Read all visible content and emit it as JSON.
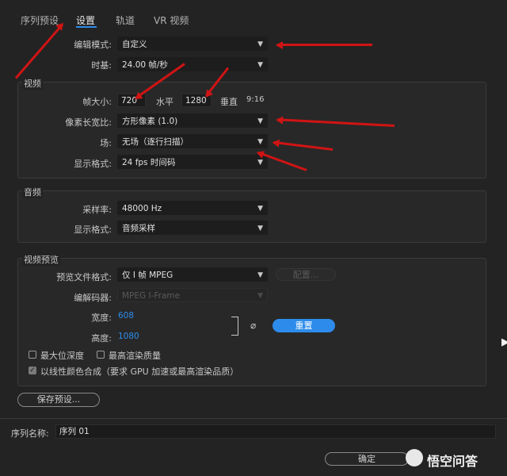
{
  "tabs": [
    {
      "label": "序列预设"
    },
    {
      "label": "设置"
    },
    {
      "label": "轨道"
    },
    {
      "label": "VR 视频"
    }
  ],
  "general": {
    "edit_mode_label": "编辑模式:",
    "edit_mode_value": "自定义",
    "timebase_label": "时基:",
    "timebase_value": "24.00 帧/秒"
  },
  "video": {
    "title": "视频",
    "frame_size_label": "帧大小:",
    "frame_width": "720",
    "horizontal_label": "水平",
    "frame_height": "1280",
    "vertical_label": "垂直",
    "aspect": "9:16",
    "pixel_aspect_label": "像素长宽比:",
    "pixel_aspect_value": "方形像素 (1.0)",
    "fields_label": "场:",
    "fields_value": "无场（逐行扫描）",
    "display_format_label": "显示格式:",
    "display_format_value": "24 fps 时间码"
  },
  "audio": {
    "title": "音频",
    "sample_rate_label": "采样率:",
    "sample_rate_value": "48000 Hz",
    "display_format_label": "显示格式:",
    "display_format_value": "音频采样"
  },
  "preview": {
    "title": "视频预览",
    "file_format_label": "预览文件格式:",
    "file_format_value": "仅 I 帧 MPEG",
    "configure_label": "配置...",
    "codec_label": "编解码器:",
    "codec_value": "MPEG I-Frame",
    "width_label": "宽度:",
    "width_value": "608",
    "height_label": "高度:",
    "height_value": "1080",
    "reset_label": "重置",
    "max_bit_depth_label": "最大位深度",
    "max_render_quality_label": "最高渲染质量",
    "linear_color_label": "以线性颜色合成（要求 GPU 加速或最高渲染品质）"
  },
  "save_preset_label": "保存预设...",
  "sequence_name_label": "序列名称:",
  "sequence_name_value": "序列 01",
  "ok_label": "确定",
  "watermark": "悟空问答",
  "colors": {
    "accent": "#2d8ceb",
    "annotation_arrow": "#d01414"
  }
}
